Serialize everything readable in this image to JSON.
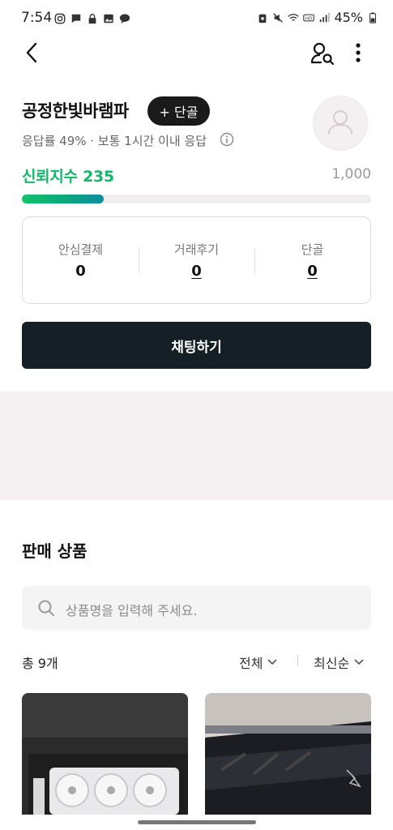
{
  "status_bar": {
    "time": "7:54",
    "battery": "45%",
    "left_icons": [
      "instagram-icon",
      "message-icon",
      "lock-icon",
      "gallery-icon",
      "chat-bubble-icon"
    ],
    "right_icons": [
      "alarm-icon",
      "mute-icon",
      "wifi-icon",
      "hd-icon",
      "signal-icon",
      "battery-icon"
    ]
  },
  "header": {
    "back_icon": "back-arrow-icon",
    "profile_search_icon": "user-search-icon",
    "more_icon": "more-vertical-icon"
  },
  "seller": {
    "name": "공정한빛바램파",
    "regular_button": "+ 단골",
    "response_info": "응답률 49% · 보통 1시간 이내 응답",
    "avatar_icon": "user-avatar-icon",
    "trust_label": "신뢰지수",
    "trust_value": "235",
    "trust_max": "1,000",
    "trust_progress": 0.235
  },
  "stats": [
    {
      "label": "안심결제",
      "value": "0"
    },
    {
      "label": "거래후기",
      "value": "0"
    },
    {
      "label": "단골",
      "value": "0"
    }
  ],
  "chat_button": "채팅하기",
  "products": {
    "title": "판매 상품",
    "search_placeholder": "상품명을 입력해 주세요.",
    "count": "총 9개",
    "filter_all": "전체",
    "sort": "최신순"
  },
  "colors": {
    "trust_green": "#11b86a",
    "chat_button_bg": "#142026",
    "band_bg": "#f6f1f3"
  }
}
